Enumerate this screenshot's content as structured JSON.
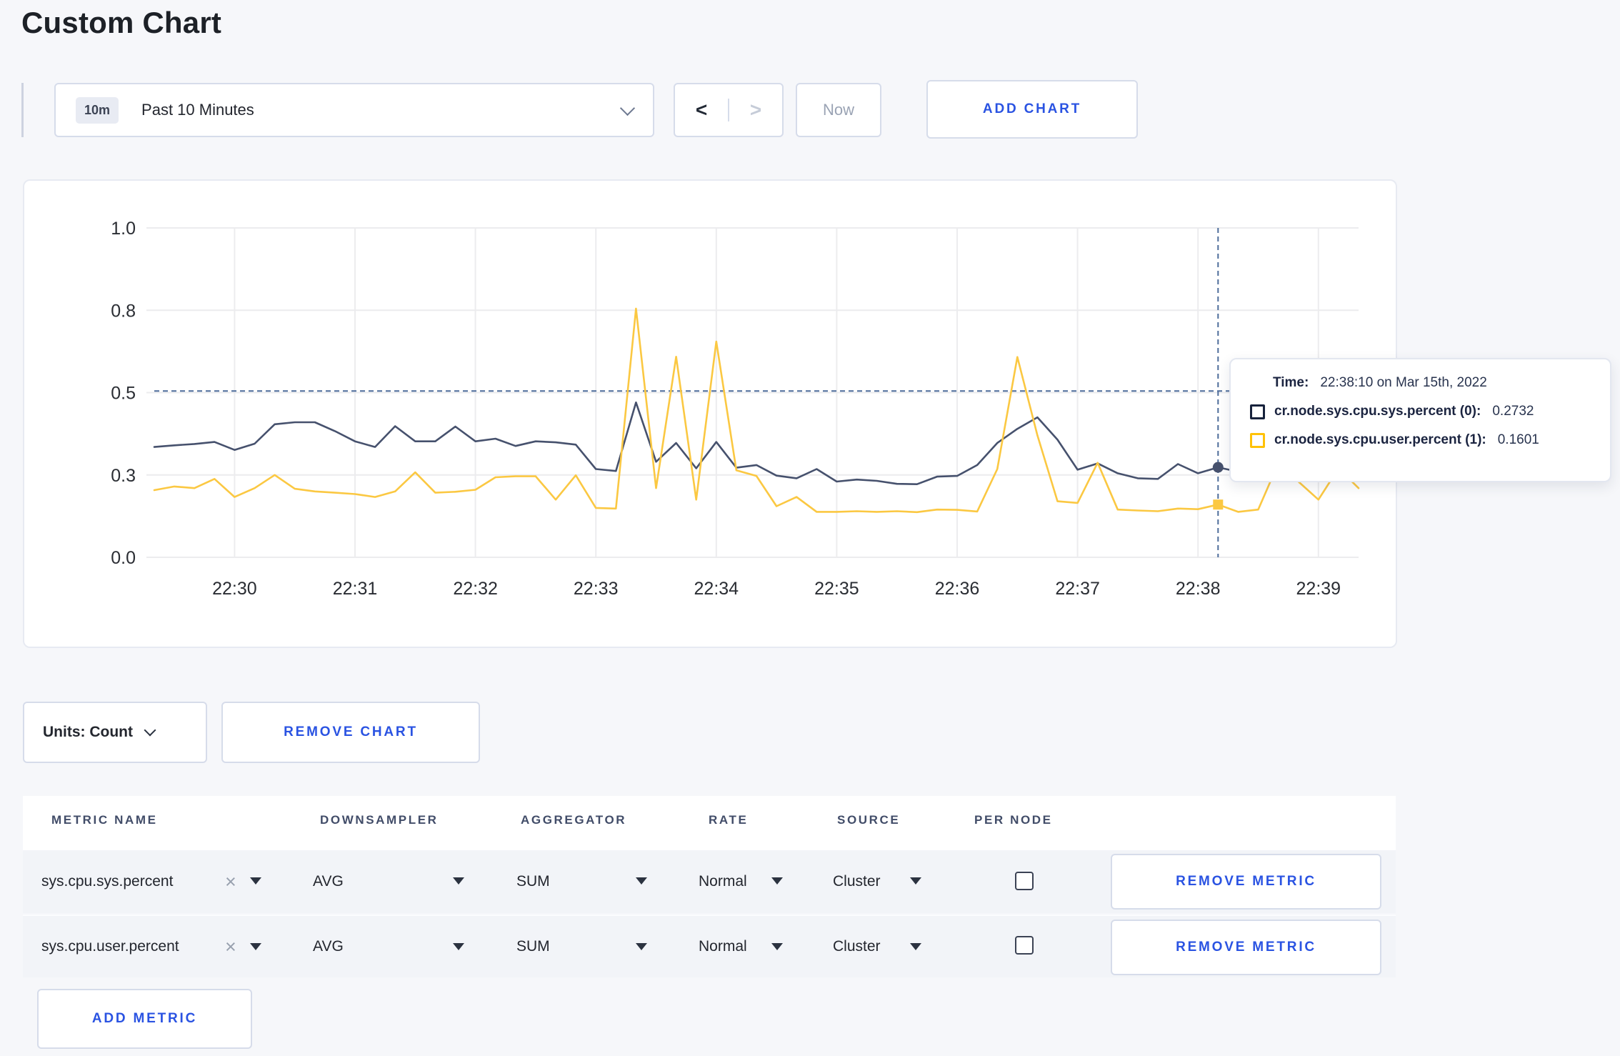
{
  "page": {
    "title": "Custom Chart",
    "background": "#f6f7fa",
    "accent_blue": "#2a53e2"
  },
  "toolbar": {
    "time_selector": {
      "badge": "10m",
      "label": "Past 10 Minutes"
    },
    "prev": "<",
    "next": ">",
    "now": "Now",
    "add_chart": "ADD CHART"
  },
  "chart_data": {
    "type": "line",
    "title": "",
    "xlabel": "",
    "ylabel": "",
    "ylim": [
      0,
      1
    ],
    "duration_s": 600,
    "x_start": "22:29:20",
    "x_end": "22:39:20",
    "step_seconds": 10,
    "grid_color": "#ececee",
    "axis_text_color": "#2a2d33",
    "y_ticks": [
      {
        "value": 0.0,
        "label": "0.0"
      },
      {
        "value": 0.25,
        "label": "0.3"
      },
      {
        "value": 0.5,
        "label": "0.5"
      },
      {
        "value": 0.75,
        "label": "0.8"
      },
      {
        "value": 1.0,
        "label": "1.0"
      }
    ],
    "x_ticks": [
      {
        "offset_s": 40,
        "label": "22:30"
      },
      {
        "offset_s": 100,
        "label": "22:31"
      },
      {
        "offset_s": 160,
        "label": "22:32"
      },
      {
        "offset_s": 220,
        "label": "22:33"
      },
      {
        "offset_s": 280,
        "label": "22:34"
      },
      {
        "offset_s": 340,
        "label": "22:35"
      },
      {
        "offset_s": 400,
        "label": "22:36"
      },
      {
        "offset_s": 460,
        "label": "22:37"
      },
      {
        "offset_s": 520,
        "label": "22:38"
      },
      {
        "offset_s": 580,
        "label": "22:39"
      }
    ],
    "series": [
      {
        "name": "cr.node.sys.cpu.sys.percent",
        "color": "#46516d",
        "swatch": "#17223c",
        "values": [
          0.335,
          0.34,
          0.344,
          0.35,
          0.326,
          0.345,
          0.404,
          0.41,
          0.41,
          0.383,
          0.352,
          0.335,
          0.398,
          0.352,
          0.352,
          0.397,
          0.352,
          0.36,
          0.338,
          0.352,
          0.349,
          0.342,
          0.268,
          0.262,
          0.47,
          0.29,
          0.347,
          0.27,
          0.35,
          0.272,
          0.28,
          0.248,
          0.24,
          0.268,
          0.23,
          0.236,
          0.232,
          0.223,
          0.222,
          0.245,
          0.247,
          0.28,
          0.347,
          0.39,
          0.425,
          0.357,
          0.266,
          0.285,
          0.255,
          0.24,
          0.238,
          0.283,
          0.255,
          0.2732,
          0.26,
          0.262,
          0.258,
          0.261,
          0.257,
          0.262,
          0.258
        ]
      },
      {
        "name": "cr.node.sys.cpu.user.percent",
        "color": "#fbc842",
        "swatch": "#ffc208",
        "values": [
          0.204,
          0.215,
          0.21,
          0.238,
          0.183,
          0.21,
          0.25,
          0.208,
          0.2,
          0.196,
          0.192,
          0.183,
          0.2,
          0.258,
          0.196,
          0.199,
          0.205,
          0.243,
          0.246,
          0.246,
          0.175,
          0.249,
          0.15,
          0.148,
          0.755,
          0.21,
          0.609,
          0.175,
          0.655,
          0.264,
          0.247,
          0.155,
          0.183,
          0.138,
          0.138,
          0.14,
          0.138,
          0.14,
          0.137,
          0.145,
          0.144,
          0.139,
          0.268,
          0.608,
          0.37,
          0.17,
          0.165,
          0.287,
          0.145,
          0.142,
          0.14,
          0.148,
          0.146,
          0.1601,
          0.138,
          0.145,
          0.285,
          0.23,
          0.175,
          0.27,
          0.21
        ]
      }
    ],
    "crosshair": {
      "offset_s": 530,
      "hline_value": 0.505,
      "color": "#4e6d9b",
      "points": [
        {
          "series": 0,
          "value": 0.2732,
          "marker": "circle"
        },
        {
          "series": 1,
          "value": 0.1601,
          "marker": "square"
        }
      ]
    },
    "legend_position": "tooltip"
  },
  "tooltip": {
    "time_label": "Time:",
    "time_value": "22:38:10 on Mar 15th, 2022",
    "rows": [
      {
        "label": "cr.node.sys.cpu.sys.percent (0):",
        "value": "0.2732",
        "swatch": "#17223c"
      },
      {
        "label": "cr.node.sys.cpu.user.percent (1):",
        "value": "0.1601",
        "swatch": "#ffc208"
      }
    ]
  },
  "chart_footer": {
    "units_label": "Units: Count",
    "remove_chart_label": "REMOVE CHART"
  },
  "metrics_table": {
    "headers": [
      "METRIC NAME",
      "DOWNSAMPLER",
      "AGGREGATOR",
      "RATE",
      "SOURCE",
      "PER NODE"
    ],
    "rows": [
      {
        "metric": "sys.cpu.sys.percent",
        "downsampler": "AVG",
        "aggregator": "SUM",
        "rate": "Normal",
        "source": "Cluster",
        "per_node_checked": false,
        "remove_label": "REMOVE METRIC"
      },
      {
        "metric": "sys.cpu.user.percent",
        "downsampler": "AVG",
        "aggregator": "SUM",
        "rate": "Normal",
        "source": "Cluster",
        "per_node_checked": false,
        "remove_label": "REMOVE METRIC"
      }
    ],
    "add_metric_label": "ADD METRIC"
  },
  "icons": {
    "remove_x": "×"
  }
}
